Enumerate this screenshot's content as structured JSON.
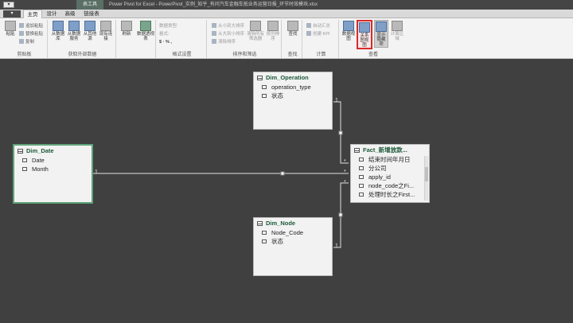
{
  "window": {
    "file_button": "▾",
    "context_tab": "表工具",
    "title": "Power Pivot for Excel - PowerPivot_实例_知乎_有问汽车金融车抵业务运营日报_环节时效模块.xlsx"
  },
  "tabs": [
    "主页",
    "设计",
    "高级",
    "链接表"
  ],
  "ribbon": {
    "groups": {
      "clipboard": "剪贴板",
      "external": "获取外部数据",
      "formatting": "格式设置",
      "sort": "排序和筛选",
      "find": "查找",
      "calc": "计算",
      "view": "查看"
    },
    "buttons": {
      "paste": "粘贴",
      "paste_append": "追加粘贴",
      "paste_replace": "替换粘贴",
      "copy": "复制",
      "from_db": "从数据库",
      "from_service": "从数据服务",
      "from_other": "从其他源",
      "existing": "现有连接",
      "refresh": "刷新",
      "pivot": "数据透视表",
      "data_type": "数据类型:",
      "format": "格式:",
      "fmt_symbols": "$ · % ,",
      "sort_asc": "从小到大排序",
      "sort_desc": "从大到小排序",
      "clear_sort": "清除排序",
      "clear_filters": "清除所有筛选器",
      "sort_by_col": "按列排序",
      "find": "查找",
      "autosum": "自动汇总",
      "create_kpi": "创建 KPI",
      "data_view": "数据视图",
      "diagram_view": "关系图视图",
      "show_hidden": "显示隐藏项",
      "calc_area": "计算区域"
    }
  },
  "diagram": {
    "tables": [
      {
        "id": "dim_operation",
        "title": "Dim_Operation",
        "columns": [
          "operation_type",
          "状态"
        ]
      },
      {
        "id": "dim_date",
        "title": "Dim_Date",
        "columns": [
          "Date",
          "Month"
        ]
      },
      {
        "id": "fact",
        "title": "Fact_新增放款...",
        "columns": [
          "结束时间年月日",
          "分公司",
          "apply_id",
          "node_code之Fi...",
          "处理时长之First..."
        ]
      },
      {
        "id": "dim_node",
        "title": "Dim_Node",
        "columns": [
          "Node_Code",
          "状态"
        ]
      }
    ],
    "relationships": {
      "date_one": "1",
      "date_many": "*",
      "operation_one": "1",
      "operation_many": "*",
      "node_one": "1",
      "node_many": "*"
    }
  }
}
